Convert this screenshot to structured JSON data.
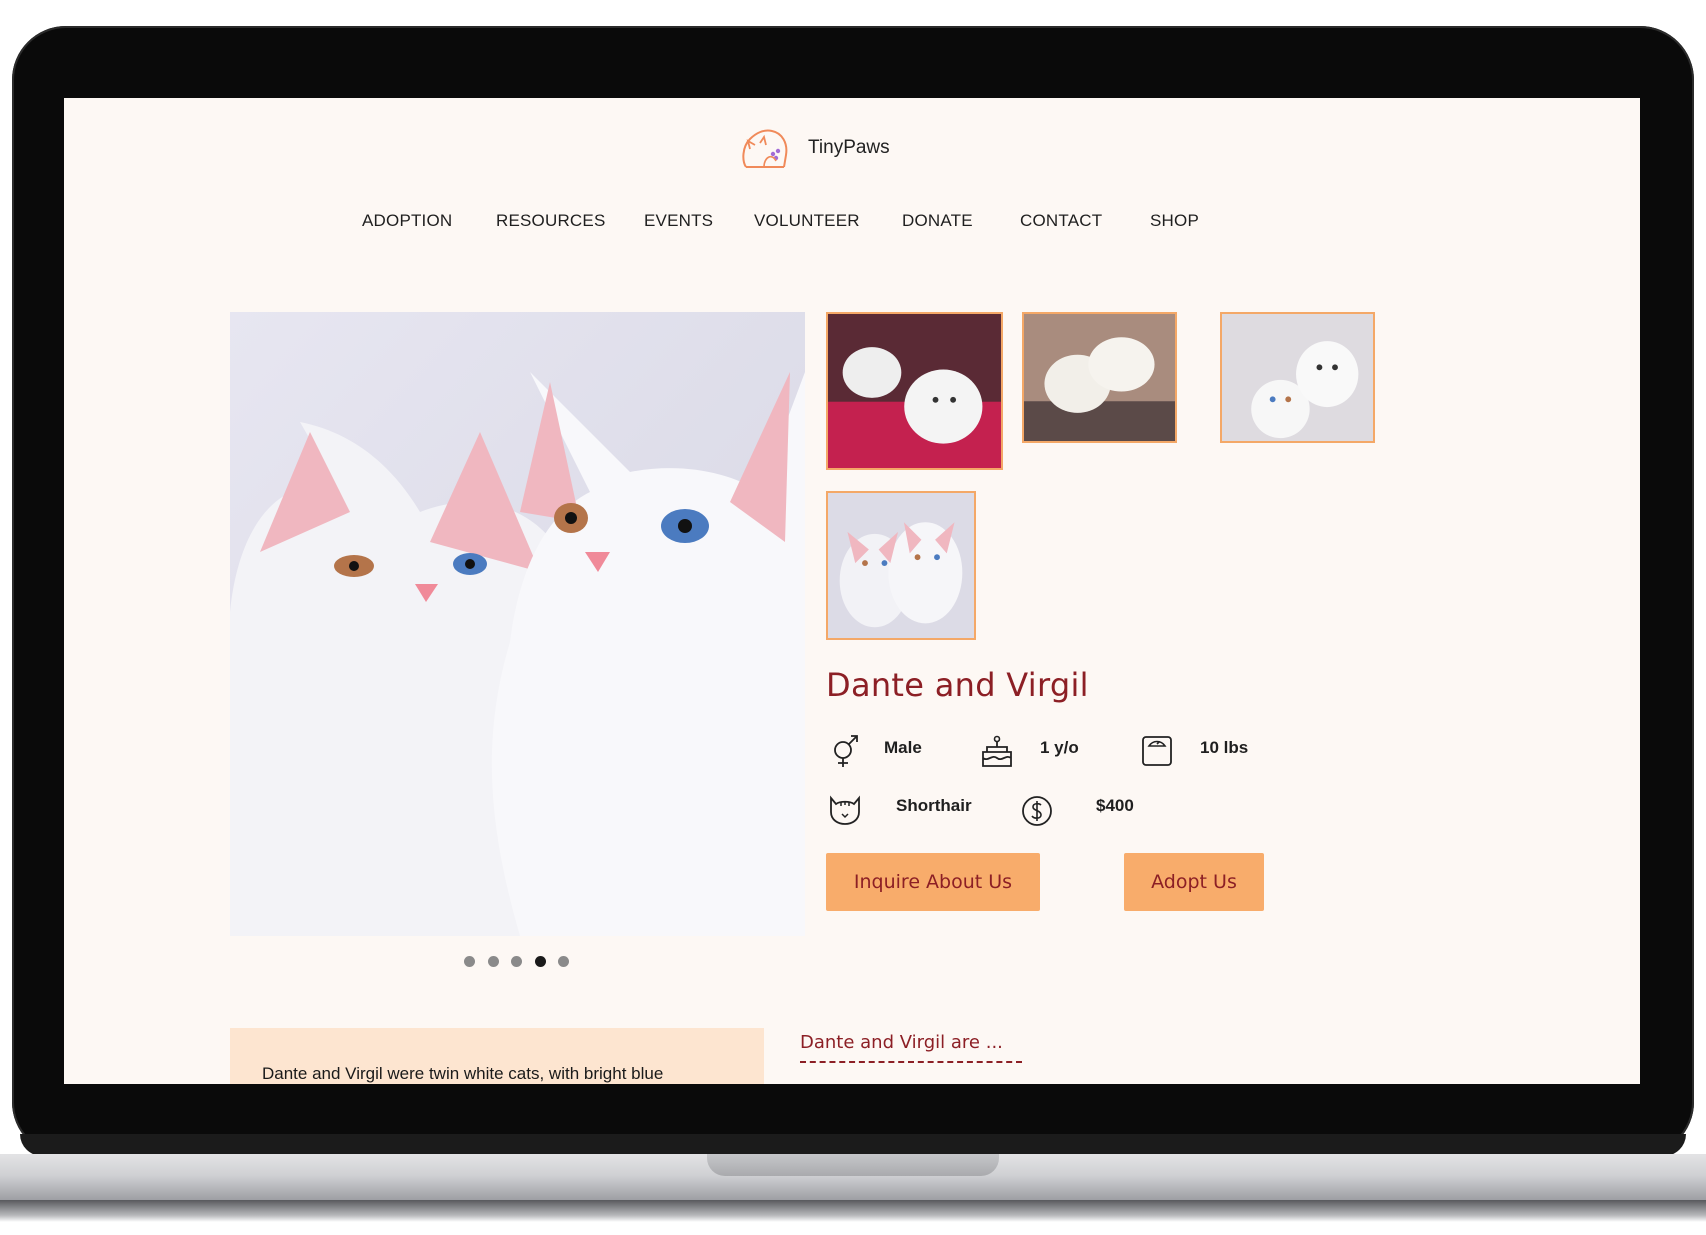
{
  "brand": {
    "name": "TinyPaws"
  },
  "nav": [
    "ADOPTION",
    "RESOURCES",
    "EVENTS",
    "VOLUNTEER",
    "DONATE",
    "CONTACT",
    "SHOP"
  ],
  "pet": {
    "name": "Dante and Virgil",
    "attributes": {
      "gender": "Male",
      "age": "1 y/o",
      "weight": "10 lbs",
      "coat": "Shorthair",
      "price": "$400"
    }
  },
  "buttons": {
    "inquire": "Inquire About Us",
    "adopt": "Adopt Us"
  },
  "carousel": {
    "total": 5,
    "active_index": 4
  },
  "about": {
    "text": "Dante and Virgil were twin white cats, with bright blue",
    "heading": "Dante and Virgil are ..."
  },
  "colors": {
    "accent": "#f8ac6b",
    "heading": "#8c1f25",
    "page_bg": "#fdf8f4",
    "desc_bg": "#fde5d0"
  }
}
